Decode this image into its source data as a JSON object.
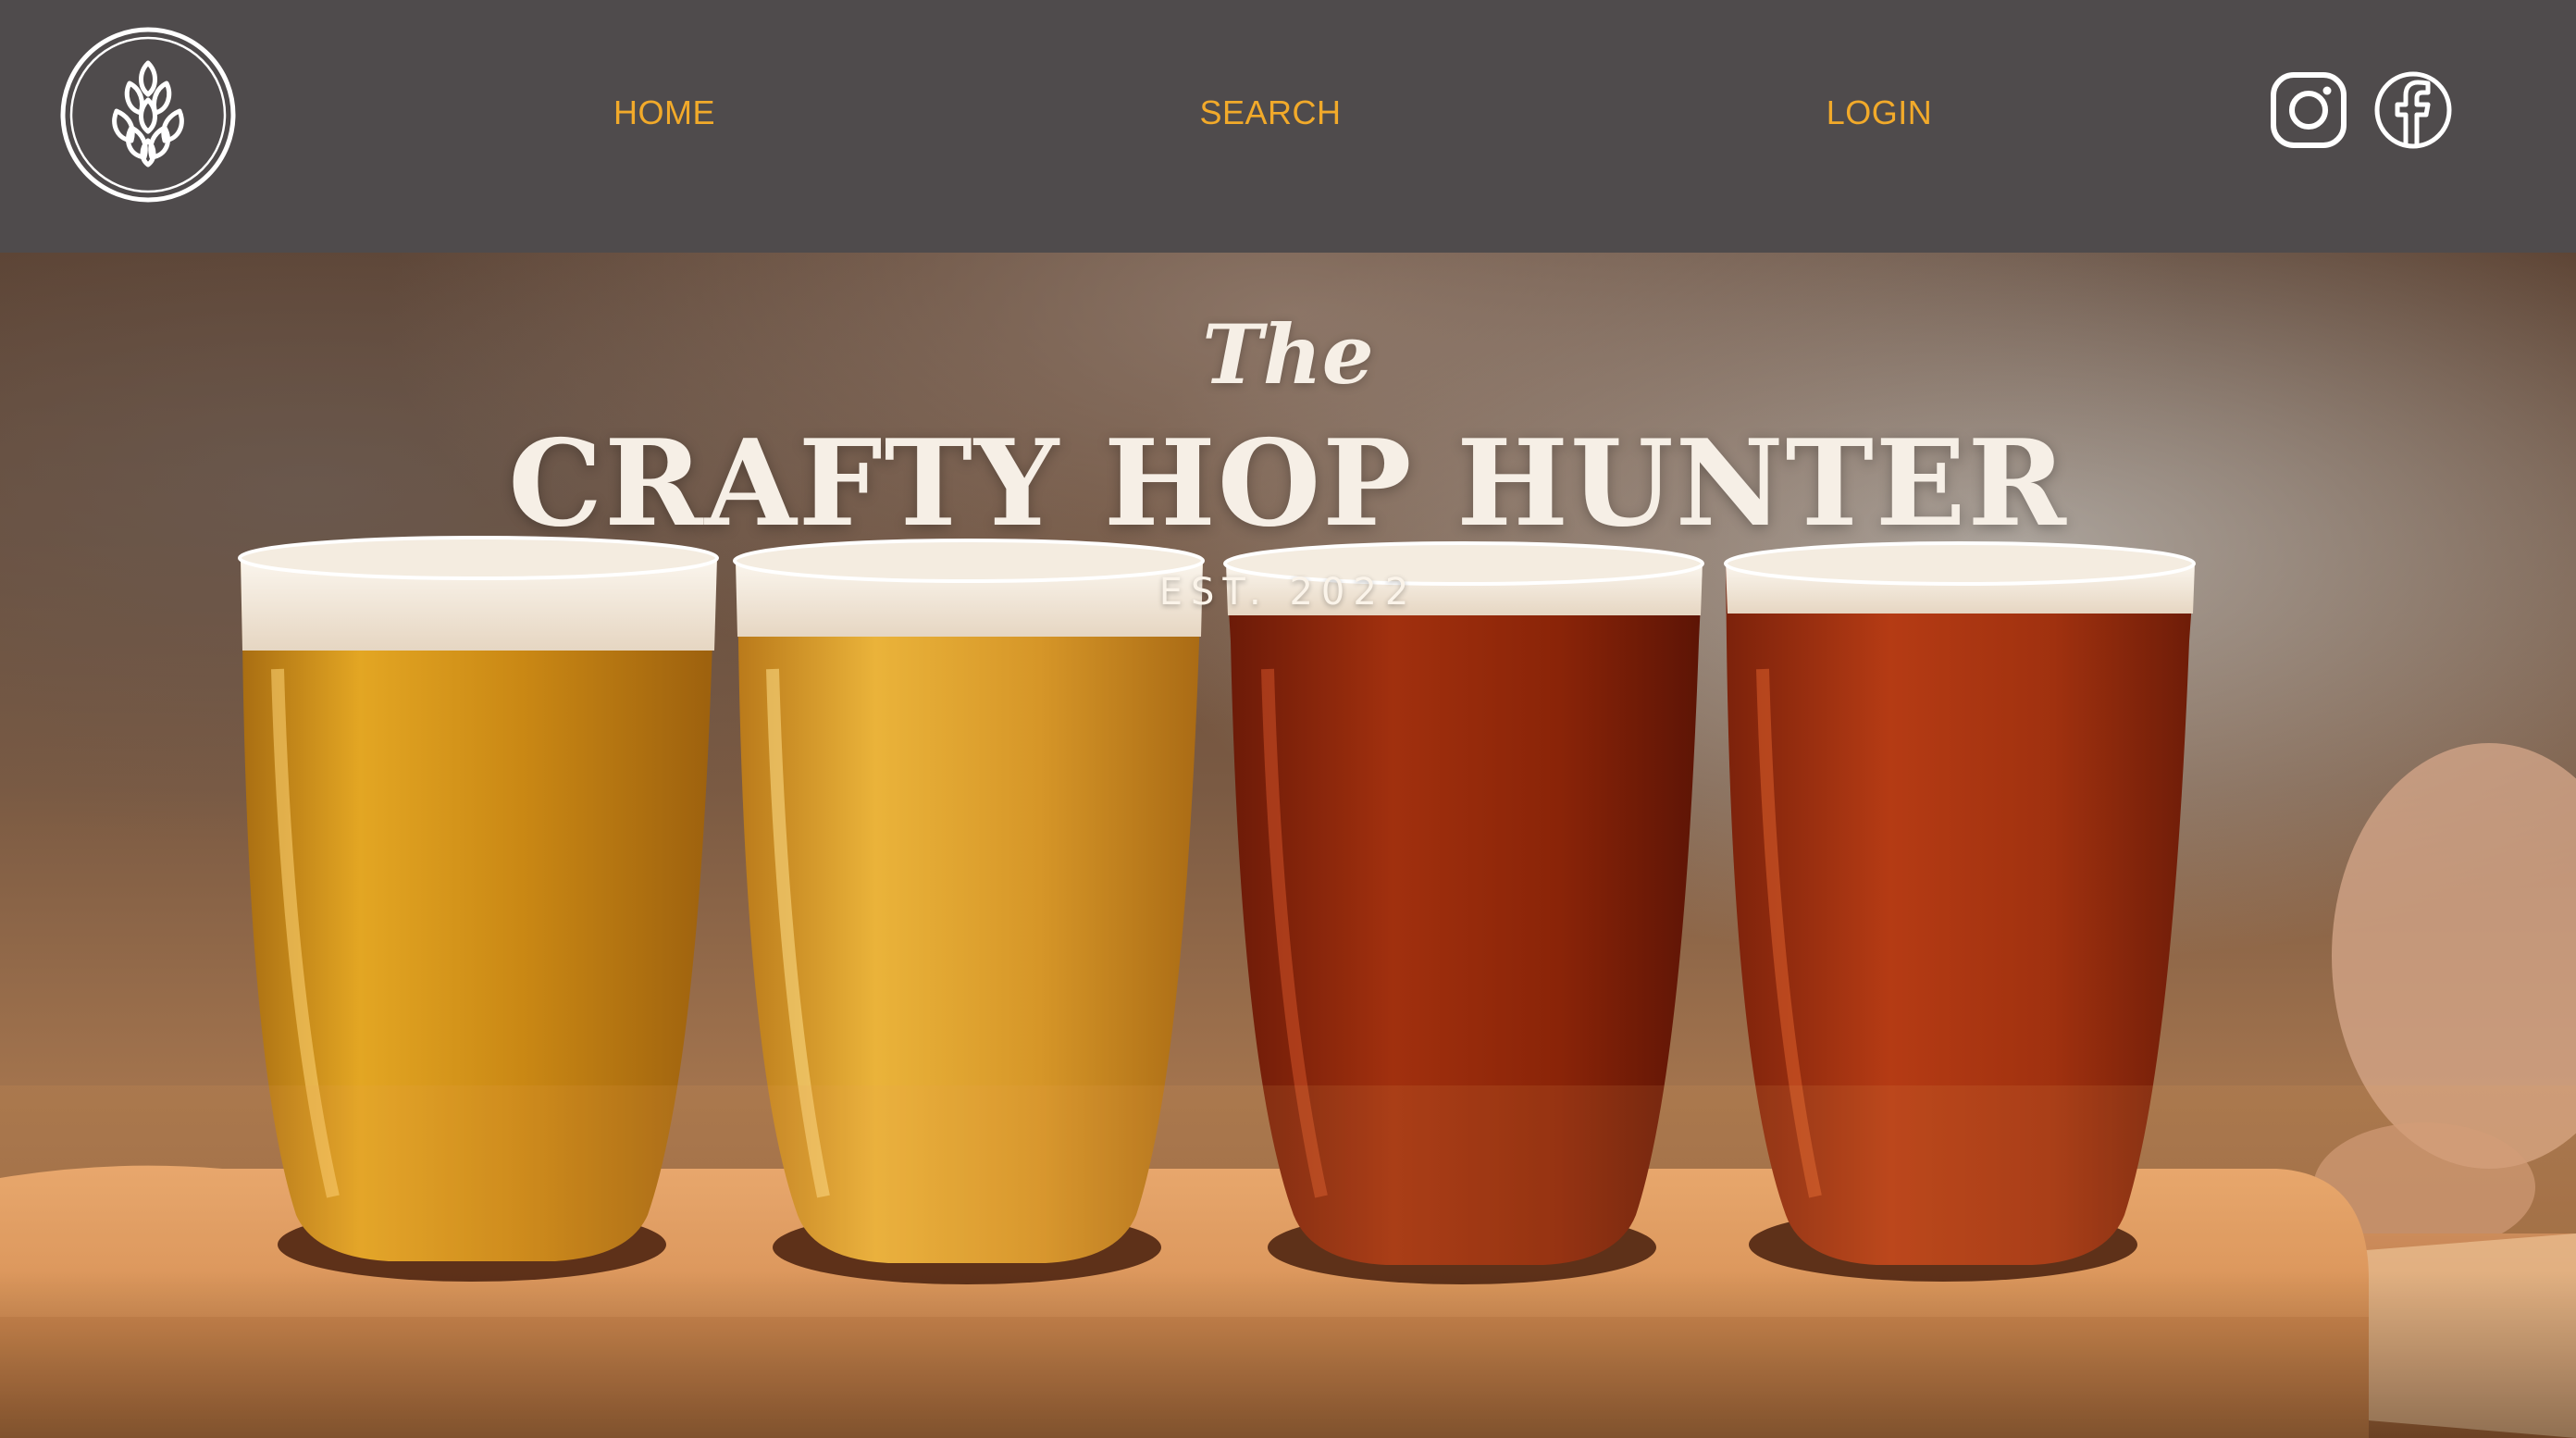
{
  "site": {
    "name_prefix": "The",
    "name": "CRAFTY HOP HUNTER",
    "established": "EST. 2022",
    "logo_icon": "hop-cone-icon"
  },
  "nav": {
    "items": [
      {
        "label": "HOME"
      },
      {
        "label": "SEARCH"
      },
      {
        "label": "LOGIN"
      }
    ]
  },
  "social": {
    "instagram_icon": "instagram-icon",
    "facebook_icon": "facebook-icon"
  },
  "colors": {
    "header_bg": "#4f4b4c",
    "nav_link": "#f2aa2a",
    "hero_text": "#f6efe6"
  },
  "hero": {
    "image": "beer-flight-photo"
  }
}
